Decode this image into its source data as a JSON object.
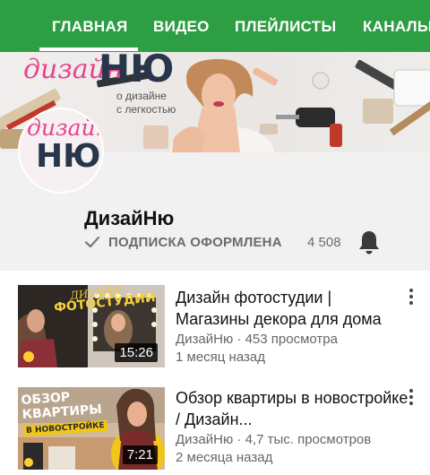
{
  "tabs": [
    {
      "label": "ГЛАВНАЯ"
    },
    {
      "label": "ВИДЕО"
    },
    {
      "label": "ПЛЕЙЛИСТЫ"
    },
    {
      "label": "КАНАЛЫ"
    }
  ],
  "banner": {
    "logo_text_1": "дизайн",
    "logo_text_2": "НЮ",
    "tagline_1": "о дизайне",
    "tagline_2": "с легкостью"
  },
  "avatar": {
    "text_1": "дизайн",
    "text_2": "НЮ"
  },
  "channel": {
    "name": "ДизайНю",
    "subscribed_label": "ПОДПИСКА ОФОРМЛЕНА",
    "subscriber_count": "4 508"
  },
  "videos": [
    {
      "title": "Дизайн фотостудии | Магазины декора для дома",
      "channel": "ДизайНю",
      "views": "453 просмотра",
      "age": "1 месяц назад",
      "duration": "15:26",
      "thumb_caption_1": "ДИЗАЙН",
      "thumb_caption_2": "ФОТОСТУДИИ"
    },
    {
      "title": "Обзор квартиры в новостройке / Дизайн...",
      "channel": "ДизайНю",
      "views": "4,7 тыс. просмотров",
      "age": "2 месяца назад",
      "duration": "7:21",
      "thumb_caption_1": "ОБЗОР",
      "thumb_caption_2": "КВАРТИРЫ",
      "thumb_caption_3": "В НОВОСТРОЙКЕ"
    }
  ],
  "colors": {
    "nav": "#2e9e44",
    "brand_pink": "#e6438c",
    "brand_dark": "#27364a"
  }
}
